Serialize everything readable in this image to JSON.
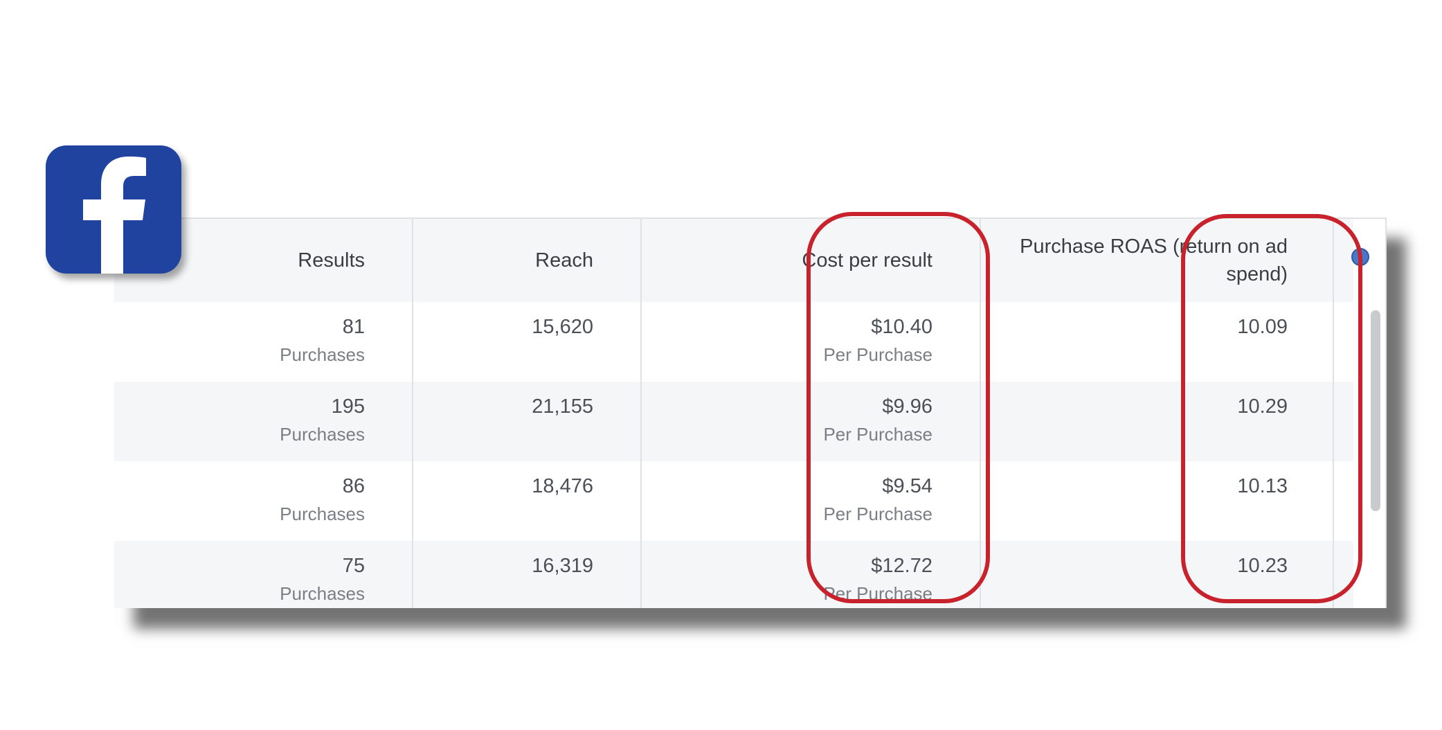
{
  "brand": {
    "icon": "facebook-logo-icon",
    "color": "#2043a0",
    "glyph": "f"
  },
  "highlight_color": "#c8232d",
  "table": {
    "columns": [
      "Results",
      "Reach",
      "Cost per result",
      "Purchase ROAS (return on ad spend)"
    ],
    "header": {
      "results": "Results",
      "reach": "Reach",
      "cost": "Cost per result",
      "roas_line1": "Purchase ROAS (return on ad",
      "roas_line2": "spend)"
    },
    "rows": [
      {
        "results": "81",
        "results_unit": "Purchases",
        "reach": "15,620",
        "cost": "$10.40",
        "cost_unit": "Per Purchase",
        "roas": "10.09"
      },
      {
        "results": "195",
        "results_unit": "Purchases",
        "reach": "21,155",
        "cost": "$9.96",
        "cost_unit": "Per Purchase",
        "roas": "10.29"
      },
      {
        "results": "86",
        "results_unit": "Purchases",
        "reach": "18,476",
        "cost": "$9.54",
        "cost_unit": "Per Purchase",
        "roas": "10.13"
      },
      {
        "results": "75",
        "results_unit": "Purchases",
        "reach": "16,319",
        "cost": "$12.72",
        "cost_unit": "Per Purchase",
        "roas": "10.23"
      }
    ]
  }
}
